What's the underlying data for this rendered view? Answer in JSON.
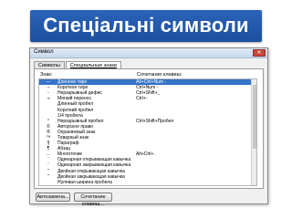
{
  "slide": {
    "title": "Спеціальні символи"
  },
  "dialog": {
    "title": "Символ",
    "tabs": [
      {
        "label": "Символы",
        "active": false
      },
      {
        "label": "Специальные знаки",
        "active": true
      }
    ],
    "columns": {
      "symbol": "Знак:",
      "shortcut": "Сочетание клавиш:"
    },
    "rows": [
      {
        "symbol": "—",
        "name": "Длинное тире",
        "shortcut": "Alt+Ctrl+Num -",
        "selected": true
      },
      {
        "symbol": "–",
        "name": "Короткое тире",
        "shortcut": "Ctrl+Num -"
      },
      {
        "symbol": "‑",
        "name": "Неразрывный дефис",
        "shortcut": "Ctrl+Shift+_"
      },
      {
        "symbol": "¬",
        "name": "Мягкий перенос",
        "shortcut": "Ctrl+-"
      },
      {
        "symbol": "",
        "name": "Длинный пробел",
        "shortcut": ""
      },
      {
        "symbol": "",
        "name": "Короткий пробел",
        "shortcut": ""
      },
      {
        "symbol": "",
        "name": "1/4 пробела",
        "shortcut": ""
      },
      {
        "symbol": "°",
        "name": "Неразрывный пробел",
        "shortcut": "Ctrl+Shift+Пробел"
      },
      {
        "symbol": "©",
        "name": "Авторское право",
        "shortcut": ""
      },
      {
        "symbol": "®",
        "name": "Охраняемый знак",
        "shortcut": ""
      },
      {
        "symbol": "™",
        "name": "Товарный знак",
        "shortcut": ""
      },
      {
        "symbol": "§",
        "name": "Параграф",
        "shortcut": ""
      },
      {
        "symbol": "¶",
        "name": "Абзац",
        "shortcut": ""
      },
      {
        "symbol": "…",
        "name": "Многоточие",
        "shortcut": "Alt+Ctrl+."
      },
      {
        "symbol": "'",
        "name": "Одинарная открывающая кавычка",
        "shortcut": ""
      },
      {
        "symbol": "'",
        "name": "Одинарная закрывающая кавычка",
        "shortcut": ""
      },
      {
        "symbol": "\"",
        "name": "Двойная открывающая кавычка",
        "shortcut": ""
      },
      {
        "symbol": "\"",
        "name": "Двойная закрывающая кавычка",
        "shortcut": ""
      },
      {
        "symbol": "",
        "name": "Нулевая ширина пробела",
        "shortcut": ""
      },
      {
        "symbol": "",
        "name": "Нулевая неразрывная связка",
        "shortcut": ""
      },
      {
        "symbol": "",
        "name": "Неразрывная связка",
        "shortcut": ""
      }
    ],
    "buttons": {
      "autocorrect": "Автозамена...",
      "shortcut": "Сочетание клавиш..."
    },
    "close_glyph": "✕"
  },
  "colors": {
    "title_bg": "#1d4f9e",
    "selected_row": "#3574c8"
  }
}
